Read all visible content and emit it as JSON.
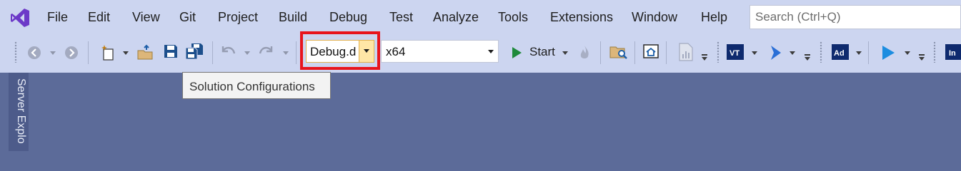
{
  "menu": {
    "items": [
      "File",
      "Edit",
      "View",
      "Git",
      "Project",
      "Build",
      "Debug",
      "Test",
      "Analyze",
      "Tools",
      "Extensions",
      "Window",
      "Help"
    ],
    "search_placeholder": "Search (Ctrl+Q)"
  },
  "toolbar": {
    "configuration_value": "Debug.d",
    "platform_value": "x64",
    "start_label": "Start"
  },
  "tooltip": {
    "text": "Solution Configurations"
  },
  "side_panel": {
    "server_explorer_label": "Server Explo"
  },
  "colors": {
    "menubar_bg": "#ccd5f0",
    "workspace_bg": "#5c6b99",
    "highlight": "#e8141c",
    "accent_purple": "#6c39c8",
    "start_green": "#1e8a3b"
  }
}
